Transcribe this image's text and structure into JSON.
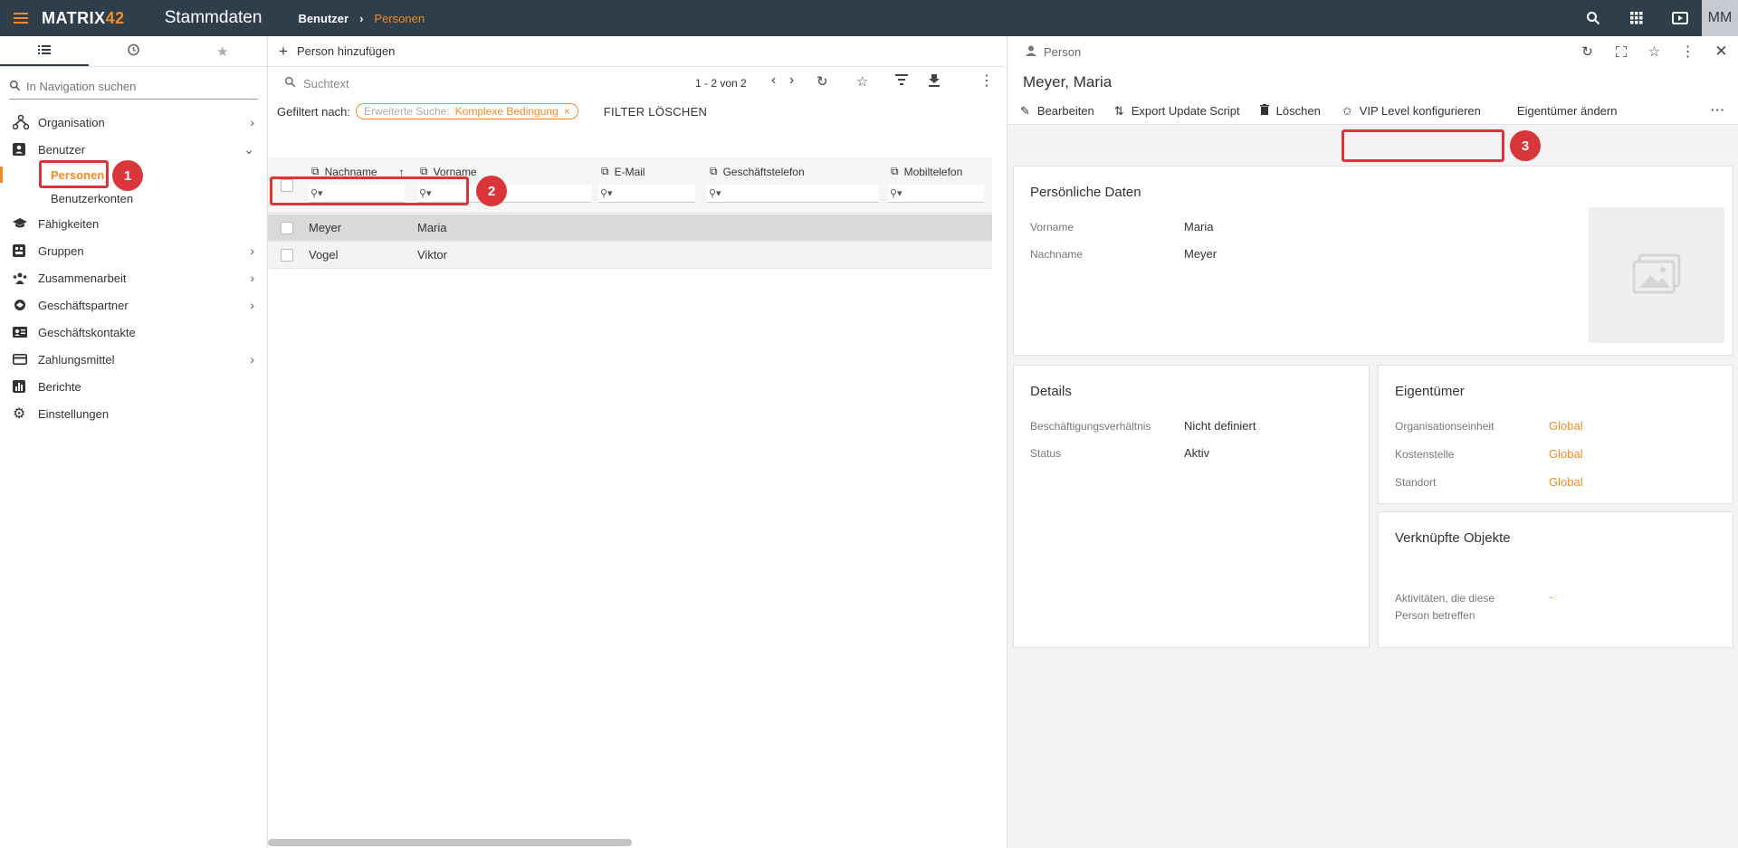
{
  "topbar": {
    "logo_main": "MATRIX",
    "logo_num": "42",
    "app_title": "Stammdaten",
    "breadcrumb": [
      "Benutzer",
      "Personen"
    ],
    "avatar": "MM"
  },
  "nav": {
    "search_placeholder": "In Navigation suchen",
    "items": [
      {
        "label": "Organisation",
        "icon": "organisation-icon",
        "expandable": true
      },
      {
        "label": "Benutzer",
        "icon": "user-card-icon",
        "expandable": true,
        "expanded": true,
        "children": [
          {
            "label": "Personen",
            "active": true
          },
          {
            "label": "Benutzerkonten"
          }
        ]
      },
      {
        "label": "Fähigkeiten",
        "icon": "graduation-cap-icon"
      },
      {
        "label": "Gruppen",
        "icon": "groups-icon",
        "expandable": true
      },
      {
        "label": "Zusammenarbeit",
        "icon": "collaboration-icon",
        "expandable": true
      },
      {
        "label": "Geschäftspartner",
        "icon": "handshake-icon",
        "expandable": true
      },
      {
        "label": "Geschäftskontakte",
        "icon": "contact-card-icon"
      },
      {
        "label": "Zahlungsmittel",
        "icon": "credit-card-icon",
        "expandable": true
      },
      {
        "label": "Berichte",
        "icon": "bar-chart-icon"
      },
      {
        "label": "Einstellungen",
        "icon": "gear-icon"
      }
    ]
  },
  "list": {
    "add_label": "Person hinzufügen",
    "search_placeholder": "Suchtext",
    "pager": "1 - 2 von 2",
    "filter_label": "Gefiltert nach:",
    "filter_chip_label": "Erweiterte Suche:",
    "filter_chip_value": "Komplexe Bedingung",
    "clear_filter": "FILTER LÖSCHEN",
    "columns": [
      "Nachname",
      "Vorname",
      "E-Mail",
      "Geschäftstelefon",
      "Mobiltelefon"
    ],
    "rows": [
      {
        "nachname": "Meyer",
        "vorname": "Maria",
        "selected": true
      },
      {
        "nachname": "Vogel",
        "vorname": "Viktor",
        "selected": false
      }
    ]
  },
  "detail": {
    "type_label": "Person",
    "title": "Meyer, Maria",
    "actions": [
      "Bearbeiten",
      "Export Update Script",
      "Löschen",
      "VIP Level konfigurieren",
      "Eigentümer ändern"
    ],
    "personal": {
      "heading": "Persönliche Daten",
      "fields": [
        {
          "label": "Vorname",
          "value": "Maria"
        },
        {
          "label": "Nachname",
          "value": "Meyer"
        }
      ]
    },
    "details": {
      "heading": "Details",
      "fields": [
        {
          "label": "Beschäftigungsverhältnis",
          "value": "Nicht definiert"
        },
        {
          "label": "Status",
          "value": "Aktiv"
        }
      ]
    },
    "owner": {
      "heading": "Eigentümer",
      "fields": [
        {
          "label": "Organisationseinheit",
          "value": "Global"
        },
        {
          "label": "Kostenstelle",
          "value": "Global"
        },
        {
          "label": "Standort",
          "value": "Global"
        }
      ]
    },
    "linked": {
      "heading": "Verknüpfte Objekte",
      "field_label": "Aktivitäten, die diese Person betreffen",
      "field_value": "-"
    }
  },
  "markers": [
    "1",
    "2",
    "3"
  ],
  "colors": {
    "accent": "#f28c28",
    "topbar": "#2e3e4a",
    "marker": "#d8363a"
  }
}
